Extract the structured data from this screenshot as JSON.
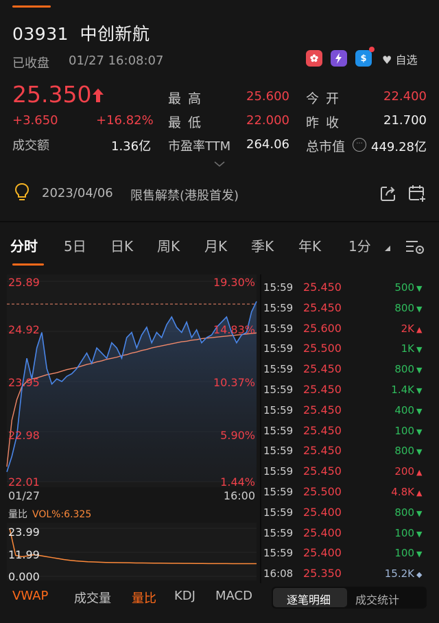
{
  "header": {
    "code": "03931",
    "name": "中创新航",
    "status": "已收盘",
    "time": "01/27 16:08:07",
    "badges": [
      "hk-flag-icon",
      "level2-icon",
      "s-icon"
    ],
    "watch_label": "自选"
  },
  "quote": {
    "price": "25.350",
    "change": "+3.650",
    "change_pct": "+16.82%",
    "turnover_label": "成交额",
    "turnover": "1.36亿",
    "high_label": "最 高",
    "high": "25.600",
    "low_label": "最 低",
    "low": "22.000",
    "pe_label": "市盈率TTM",
    "pe": "264.06",
    "open_label": "今 开",
    "open": "22.400",
    "prev_close_label": "昨 收",
    "prev_close": "21.700",
    "mktcap_label": "总市值",
    "mktcap": "449.28亿"
  },
  "notice": {
    "date": "2023/04/06",
    "text": "限售解禁(港股首发)"
  },
  "tabs": [
    "分时",
    "5日",
    "日K",
    "周K",
    "月K",
    "季K",
    "年K",
    "1分"
  ],
  "chart_data": {
    "type": "line",
    "y_labels_left": [
      "25.89",
      "24.92",
      "23.95",
      "22.98",
      "22.01"
    ],
    "y_labels_right": [
      "19.30%",
      "14.83%",
      "10.37%",
      "5.90%",
      "1.44%"
    ],
    "ylim": [
      22.01,
      25.89
    ],
    "x_labels": [
      "01/27",
      "16:00"
    ],
    "prev_close_ref": 25.45,
    "series": [
      {
        "color": "#4a86e8",
        "values": [
          22.2,
          22.5,
          22.9,
          23.8,
          24.4,
          24.0,
          24.6,
          24.9,
          24.2,
          23.9,
          24.0,
          23.95,
          24.05,
          24.1,
          24.2,
          24.35,
          24.5,
          24.3,
          24.6,
          24.5,
          24.4,
          24.7,
          24.6,
          24.4,
          24.8,
          24.9,
          24.6,
          24.85,
          25.0,
          24.7,
          24.9,
          24.8,
          25.05,
          25.2,
          25.0,
          24.9,
          25.1,
          24.8,
          24.95,
          24.7,
          24.8,
          24.85,
          25.0,
          25.1,
          25.2,
          24.9,
          24.7,
          24.85,
          24.9,
          25.3,
          25.5
        ]
      },
      {
        "color": "#f0886a",
        "values": [
          22.3,
          23.2,
          23.6,
          23.85,
          23.95,
          24.0,
          24.02,
          24.05,
          24.08,
          24.1,
          24.12,
          24.15,
          24.18,
          24.2,
          24.22,
          24.25,
          24.28,
          24.3,
          24.33,
          24.35,
          24.38,
          24.4,
          24.42,
          24.45,
          24.47,
          24.5,
          24.52,
          24.55,
          24.57,
          24.6,
          24.62,
          24.64,
          24.66,
          24.68,
          24.7,
          24.72,
          24.73,
          24.75,
          24.76,
          24.78,
          24.79,
          24.8,
          24.81,
          24.82,
          24.83,
          24.84,
          24.85,
          24.86,
          24.87,
          24.88,
          24.89
        ]
      }
    ]
  },
  "sub_chart": {
    "label": "量比",
    "indicator": "VOL%:6.325",
    "y_labels": [
      "23.99",
      "11.99",
      "0.000"
    ],
    "values": [
      23.99,
      10.5,
      9.8,
      10.2,
      10.8,
      10.4,
      9.9,
      9.4,
      8.9,
      8.4,
      8.0,
      7.7,
      7.5,
      7.3,
      7.2,
      7.05,
      6.95,
      6.9,
      6.85,
      6.8,
      6.75,
      6.7,
      6.68,
      6.65,
      6.6,
      6.58,
      6.55,
      6.52,
      6.5,
      6.48,
      6.46,
      6.44,
      6.42,
      6.4,
      6.39,
      6.38,
      6.37,
      6.36,
      6.35,
      6.34,
      6.33,
      6.325
    ]
  },
  "trades": [
    {
      "time": "15:59",
      "price": "25.450",
      "vol": "500",
      "side": "buy"
    },
    {
      "time": "15:59",
      "price": "25.450",
      "vol": "800",
      "side": "buy"
    },
    {
      "time": "15:59",
      "price": "25.600",
      "vol": "2K",
      "side": "sell"
    },
    {
      "time": "15:59",
      "price": "25.500",
      "vol": "1K",
      "side": "buy"
    },
    {
      "time": "15:59",
      "price": "25.450",
      "vol": "800",
      "side": "buy"
    },
    {
      "time": "15:59",
      "price": "25.450",
      "vol": "1.4K",
      "side": "buy"
    },
    {
      "time": "15:59",
      "price": "25.450",
      "vol": "400",
      "side": "buy"
    },
    {
      "time": "15:59",
      "price": "25.450",
      "vol": "100",
      "side": "buy"
    },
    {
      "time": "15:59",
      "price": "25.450",
      "vol": "800",
      "side": "buy"
    },
    {
      "time": "15:59",
      "price": "25.450",
      "vol": "200",
      "side": "sell"
    },
    {
      "time": "15:59",
      "price": "25.500",
      "vol": "4.8K",
      "side": "sell"
    },
    {
      "time": "15:59",
      "price": "25.400",
      "vol": "800",
      "side": "buy"
    },
    {
      "time": "15:59",
      "price": "25.400",
      "vol": "100",
      "side": "buy"
    },
    {
      "time": "15:59",
      "price": "25.400",
      "vol": "100",
      "side": "buy"
    },
    {
      "time": "16:08",
      "price": "25.350",
      "vol": "15.2K",
      "side": "neutral"
    }
  ],
  "bottom_tabs": [
    "VWAP",
    "成交量",
    "量比",
    "KDJ",
    "MACD"
  ],
  "segments": [
    "逐笔明细",
    "成交统计"
  ],
  "colors": {
    "up": "#f0414a",
    "down": "#2fbd5d",
    "accent": "#ff6a1a",
    "price_line": "#4a86e8",
    "avg_line": "#f0886a"
  }
}
